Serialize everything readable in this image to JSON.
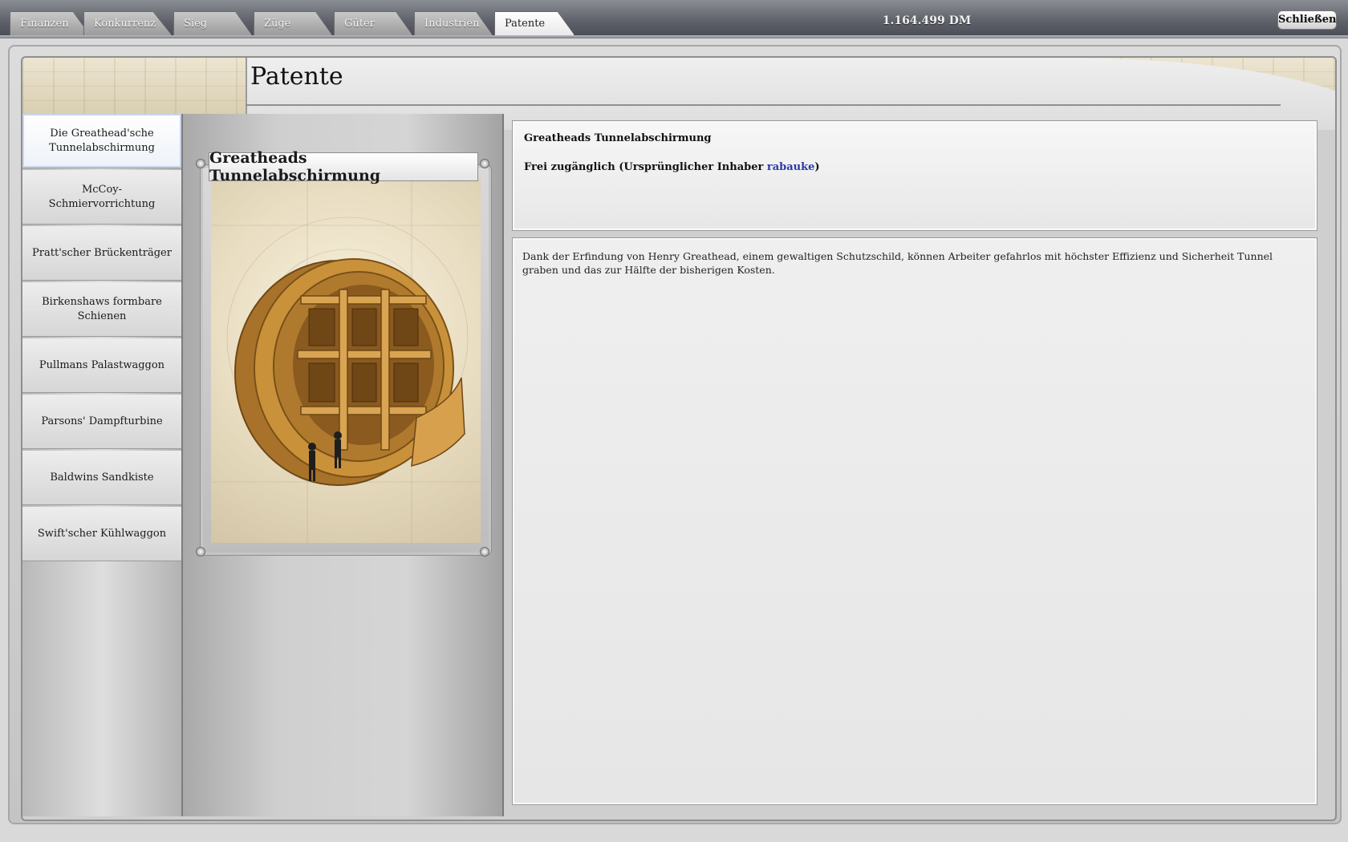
{
  "tabs": [
    {
      "label": "Finanzen",
      "active": false
    },
    {
      "label": "Konkurrenz",
      "active": false
    },
    {
      "label": "Sieg",
      "active": false
    },
    {
      "label": "Züge",
      "active": false
    },
    {
      "label": "Güter",
      "active": false
    },
    {
      "label": "Industrien",
      "active": false
    },
    {
      "label": "Patente",
      "active": true
    }
  ],
  "money": "1.164.499 DM",
  "close_label": "Schließen",
  "page_title": "Patente",
  "patents": [
    {
      "label": "Die Greathead'sche Tunnelabschirmung",
      "active": true
    },
    {
      "label": "McCoy-Schmiervorrichtung",
      "active": false
    },
    {
      "label": "Pratt'scher Brückenträger",
      "active": false
    },
    {
      "label": "Birkenshaws formbare Schienen",
      "active": false
    },
    {
      "label": "Pullmans Palastwaggon",
      "active": false
    },
    {
      "label": "Parsons' Dampfturbine",
      "active": false
    },
    {
      "label": "Baldwins Sandkiste",
      "active": false
    },
    {
      "label": "Swift'scher Kühlwaggon",
      "active": false
    }
  ],
  "card": {
    "title": "Greatheads Tunnelabschirmung"
  },
  "detail": {
    "title": "Greatheads Tunnelabschirmung",
    "status_prefix": "Frei zugänglich (Ursprünglicher Inhaber ",
    "holder": "rabauke",
    "status_suffix": ")",
    "description": "Dank der Erfindung von Henry Greathead, einem gewaltigen Schutzschild, können Arbeiter gefahrlos mit höchster Effizienz und Sicherheit Tunnel graben und das zur Hälfte der bisherigen Kosten."
  },
  "colors": {
    "link": "#2a3aa8",
    "shield": "#c9923a"
  }
}
